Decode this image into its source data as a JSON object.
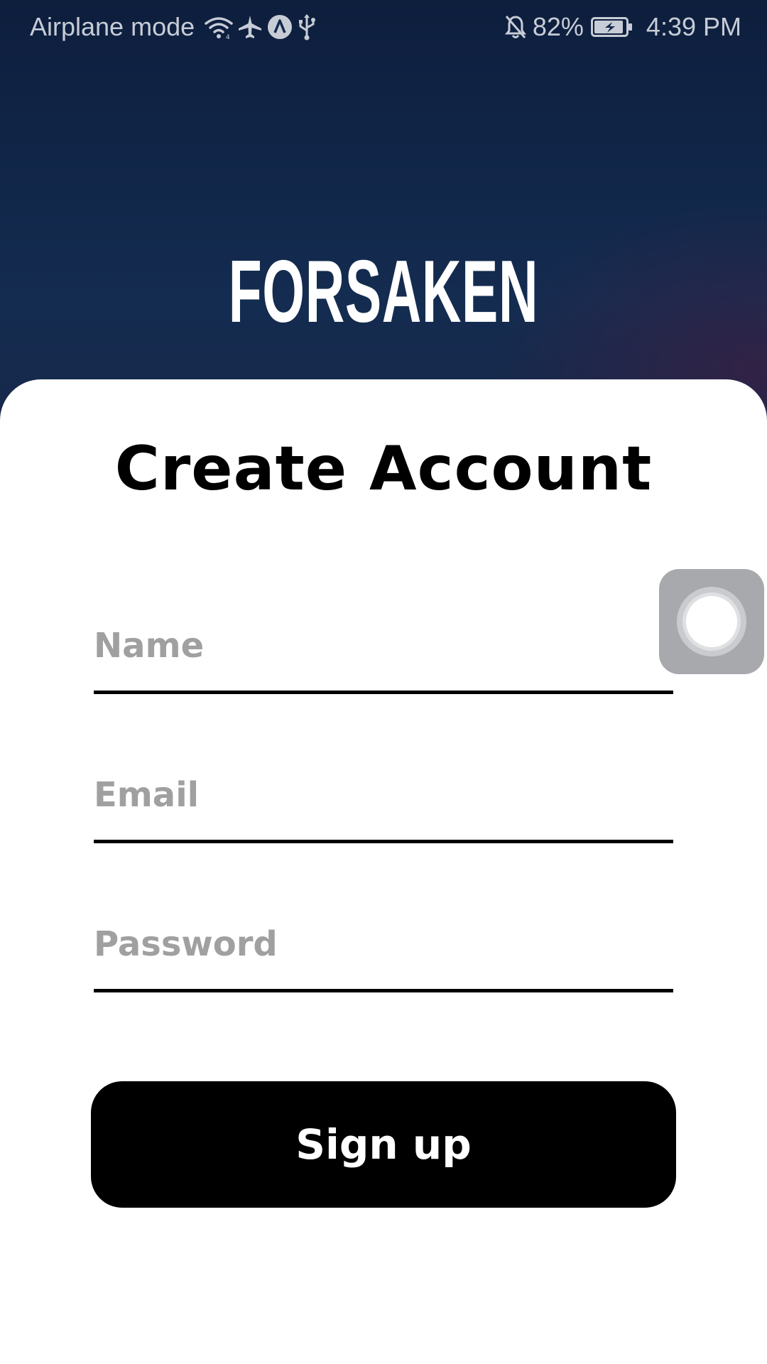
{
  "status_bar": {
    "network_label": "Airplane mode",
    "battery_percent": "82%",
    "time": "4:39 PM",
    "icons": [
      "wifi-icon",
      "airplane-icon",
      "app-a-icon",
      "usb-icon",
      "bell-off-icon",
      "battery-charging-icon"
    ]
  },
  "hero": {
    "logo_text": "FORSAKEN",
    "bg_color": "#11274a"
  },
  "form": {
    "title": "Create Account",
    "name_placeholder": "Name",
    "email_placeholder": "Email",
    "password_placeholder": "Password",
    "submit_label": "Sign up"
  },
  "colors": {
    "accent": "#000000",
    "placeholder": "#a0a0a0"
  },
  "floating": {
    "icon": "assistive-touch-icon"
  }
}
